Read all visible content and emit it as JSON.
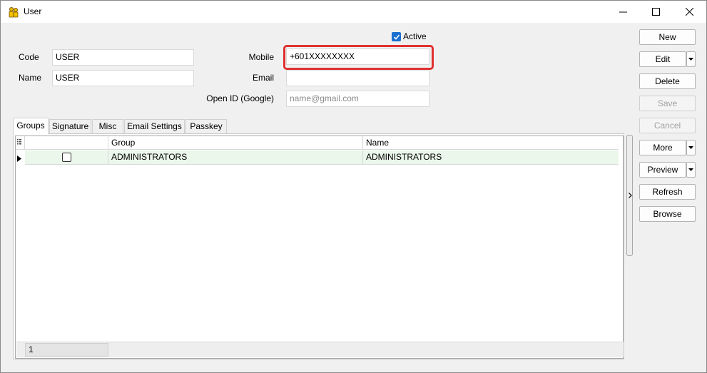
{
  "window": {
    "title": "User"
  },
  "form": {
    "active_label": "Active",
    "active_checked": true,
    "code_label": "Code",
    "code_value": "USER",
    "name_label": "Name",
    "name_value": "USER",
    "mobile_label": "Mobile",
    "mobile_value": "+601XXXXXXXX",
    "email_label": "Email",
    "email_value": "",
    "openid_label": "Open ID (Google)",
    "openid_placeholder": "name@gmail.com"
  },
  "tabs": [
    {
      "label": "Groups",
      "active": true
    },
    {
      "label": "Signature"
    },
    {
      "label": "Misc"
    },
    {
      "label": "Email Settings"
    },
    {
      "label": "Passkey"
    }
  ],
  "grid": {
    "columns": [
      "Group",
      "Name"
    ],
    "rows": [
      {
        "checked": false,
        "group": "ADMINISTRATORS",
        "name": "ADMINISTRATORS"
      }
    ],
    "footer_count": "1"
  },
  "buttons": {
    "new": "New",
    "edit": "Edit",
    "delete": "Delete",
    "save": "Save",
    "cancel": "Cancel",
    "more": "More",
    "preview": "Preview",
    "refresh": "Refresh",
    "browse": "Browse"
  },
  "colors": {
    "highlight": "#e03030",
    "selected_row": "#eaf7ea",
    "checkbox_accent": "#1a6fd0"
  }
}
